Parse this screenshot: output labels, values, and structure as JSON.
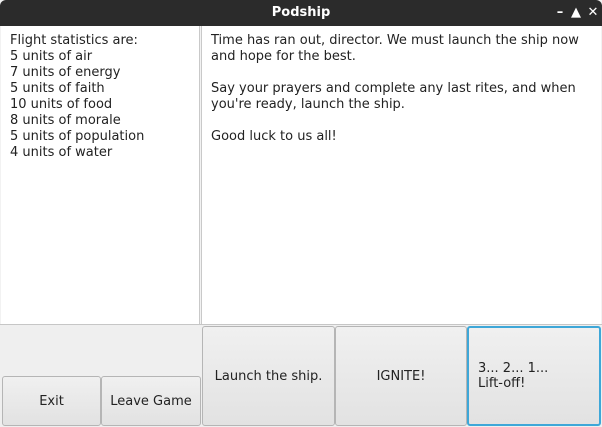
{
  "window": {
    "title": "Podship",
    "minimize_glyph": "–",
    "maximize_glyph": "▲",
    "close_glyph": "✕"
  },
  "stats": {
    "heading": "Flight statistics are:",
    "lines": [
      "5 units of air",
      "7 units of energy",
      "5 units of faith",
      "10 units of food",
      "8 units of morale",
      "5 units of population",
      "4 units of water"
    ]
  },
  "message": {
    "paragraphs": [
      "Time has ran out, director. We must launch the ship now and hope for the best.",
      "Say your prayers and complete any last rites, and when you're ready, launch the ship.",
      "Good luck to us all!"
    ]
  },
  "buttons": {
    "exit": "Exit",
    "leave_game": "Leave Game",
    "launch": "Launch the ship.",
    "ignite": "IGNITE!",
    "liftoff": "3... 2... 1...\nLift-off!"
  },
  "colors": {
    "titlebar": "#2b2b2b",
    "focus_border": "#3ea7d8"
  }
}
